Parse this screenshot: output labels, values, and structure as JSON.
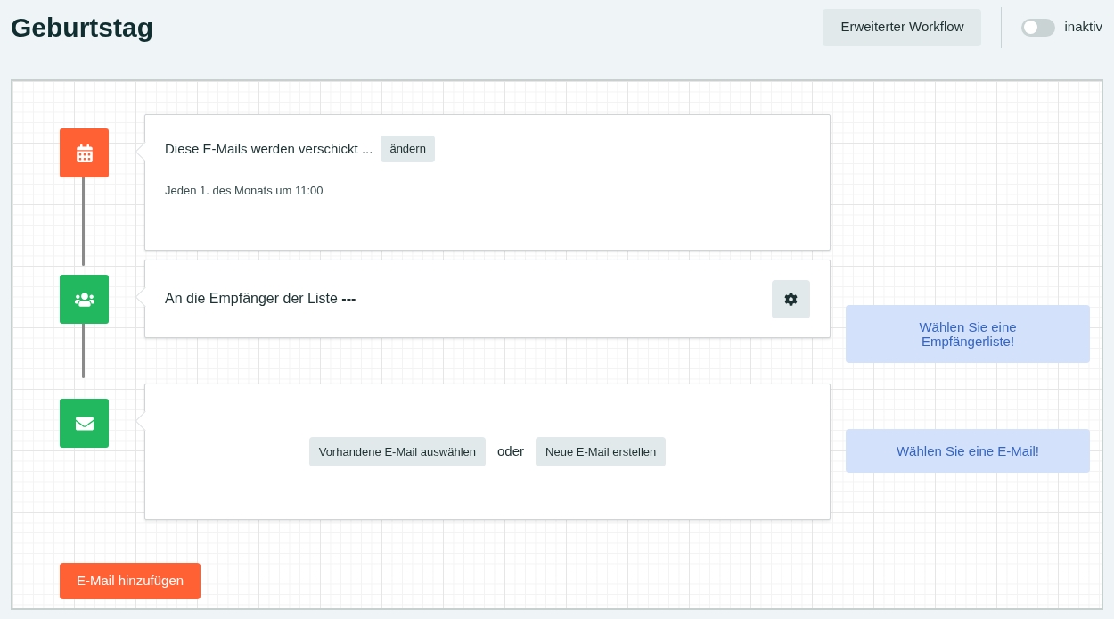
{
  "title": "Geburtstag",
  "header": {
    "workflow_button": "Erweiterter Workflow",
    "toggle": {
      "on": false,
      "label": "inaktiv"
    }
  },
  "steps": [
    {
      "kind": "schedule",
      "title": "Diese E-Mails werden verschickt ...",
      "edit_button": "ändern",
      "detail": "Jeden 1. des Monats um 11:00",
      "color": "#ff6135"
    },
    {
      "kind": "recipients",
      "title": "An die Empfänger der Liste",
      "value": "---",
      "color": "#21b85f",
      "hint": "Wählen Sie eine Empfängerliste!"
    },
    {
      "kind": "email",
      "choose_button": "Vorhandene E-Mail auswählen",
      "separator": "oder",
      "create_button": "Neue E-Mail erstellen",
      "color": "#21b85f",
      "hint": "Wählen Sie eine E-Mail!"
    }
  ],
  "add_button": "E-Mail hinzufügen"
}
